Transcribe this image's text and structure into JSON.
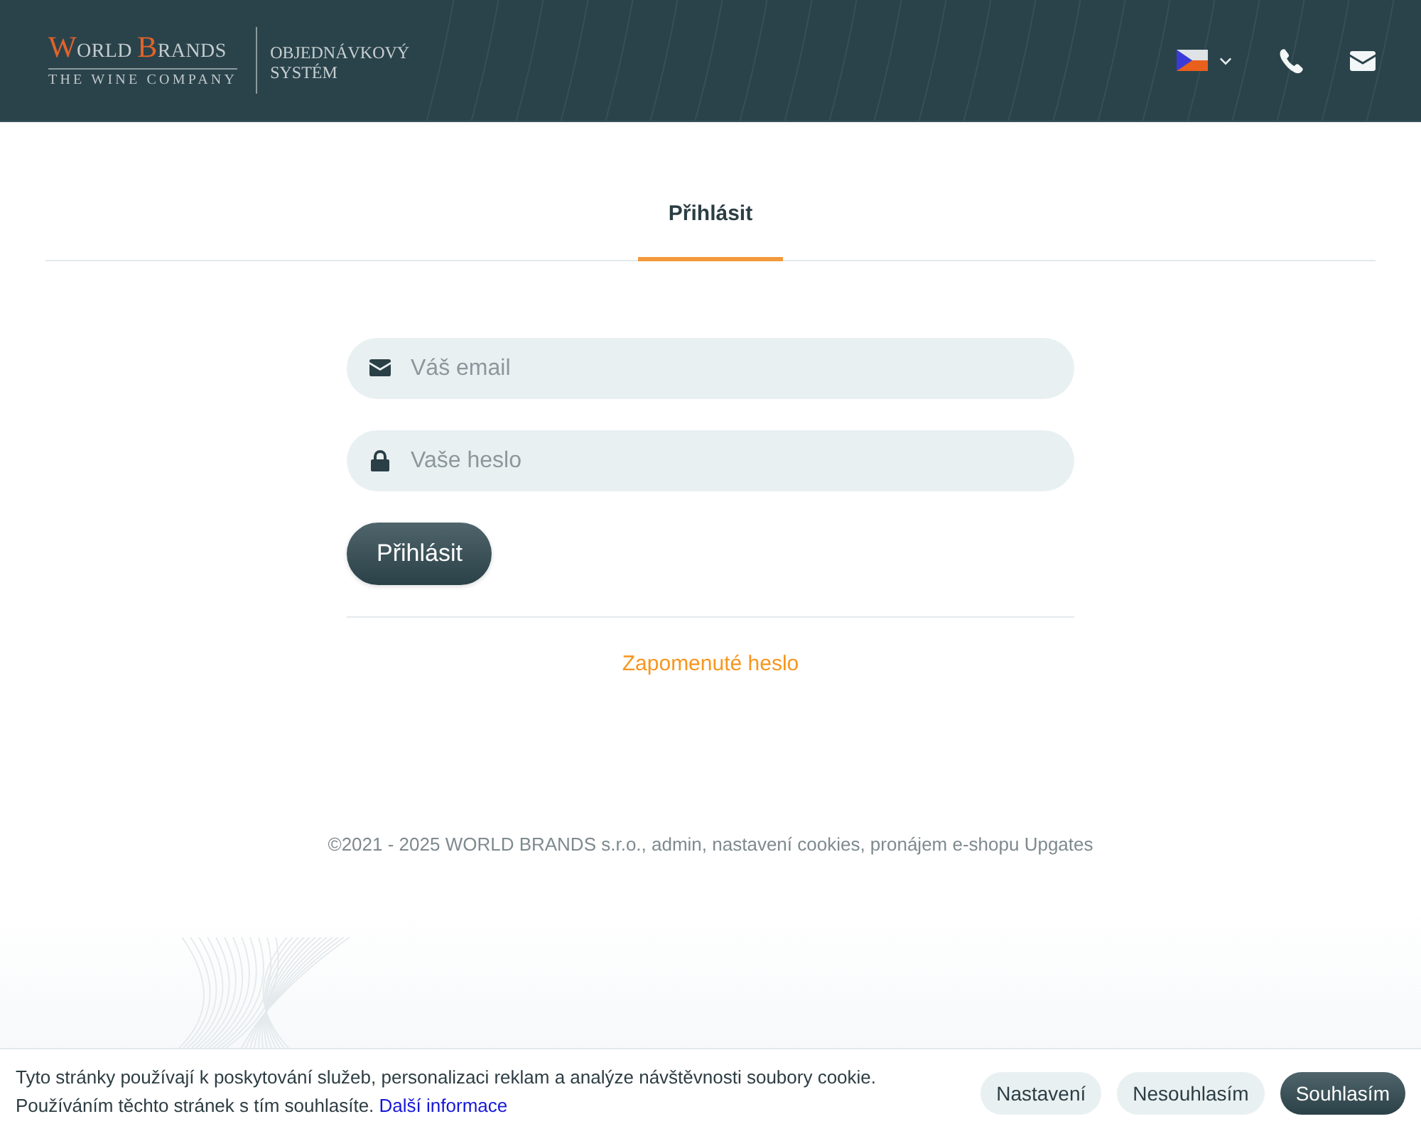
{
  "header": {
    "logo": {
      "brand_words": [
        "WORLD",
        "BRANDS"
      ],
      "tagline": "THE WINE COMPANY",
      "subtitle": "OBJEDNÁVKOVÝ SYSTÉM"
    }
  },
  "tabs": [
    {
      "label": "Přihlásit",
      "selected": true
    }
  ],
  "form": {
    "fields": [
      {
        "kind": "email",
        "placeholder": "Váš email"
      },
      {
        "kind": "password",
        "placeholder": "Vaše heslo"
      }
    ],
    "submit": "Přihlásit",
    "forgot_link": "Zapomenuté heslo"
  },
  "footer": {
    "text": "©2021 - 2025 WORLD BRANDS s.r.o., admin, nastavení cookies, pronájem e-shopu Upgates"
  },
  "cookie_bar": {
    "message": "Tyto stránky používají k poskytování služeb, personalizaci reklam a analýze návštěvnosti soubory cookie. Používáním těchto stránek s tím souhlasíte.",
    "link": "Další informace",
    "buttons": [
      {
        "label": "Nastavení",
        "kind": "secondary"
      },
      {
        "label": "Nesouhlasím",
        "kind": "secondary"
      },
      {
        "label": "Souhlasím",
        "kind": "primary"
      }
    ]
  }
}
